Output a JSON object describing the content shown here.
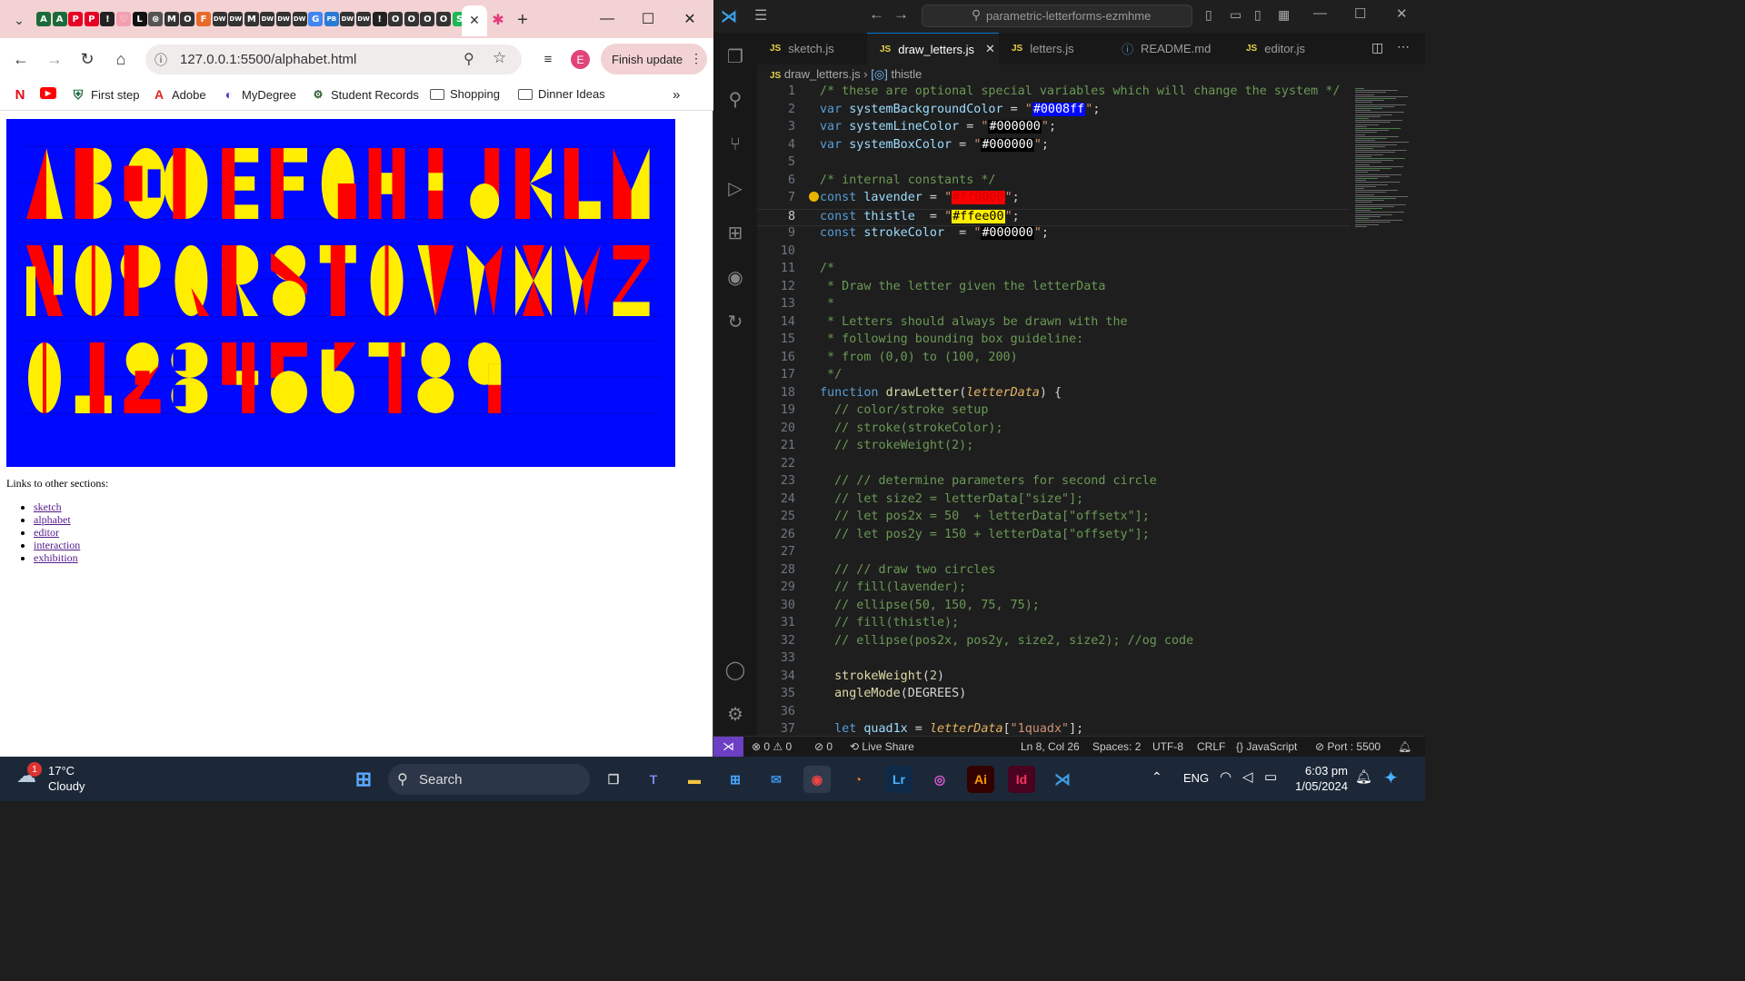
{
  "browser": {
    "favicons": [
      "A",
      "A",
      "P",
      "P",
      "!",
      "♡",
      "L",
      "⊛",
      "M",
      "O",
      "F",
      "DW",
      "DW",
      "M",
      "DW",
      "DW",
      "DW",
      "G",
      "PB",
      "DW",
      "DW",
      "!",
      "O",
      "O",
      "O",
      "O",
      "S"
    ],
    "url": "127.0.0.1:5500/alphabet.html",
    "profile_initial": "E",
    "finish_update_label": "Finish update",
    "bookmarks": [
      {
        "label": "",
        "icon": "N"
      },
      {
        "label": "",
        "icon": "▶"
      },
      {
        "label": "First step",
        "icon": "⛨"
      },
      {
        "label": "Adobe",
        "icon": "A"
      },
      {
        "label": "MyDegree",
        "icon": "◐"
      },
      {
        "label": "Student Records",
        "icon": "⚙"
      },
      {
        "label": "Shopping",
        "icon": "folder"
      },
      {
        "label": "Dinner Ideas",
        "icon": "folder"
      }
    ],
    "page": {
      "links_title": "Links to other sections:",
      "links": [
        "sketch",
        "alphabet",
        "editor",
        "interaction",
        "exhibition"
      ],
      "rows": [
        "ABCDEFGHIJKLM",
        "NOPQRSTUVWXYZ",
        "0123456789"
      ],
      "colors": {
        "background": "#0008ff",
        "primary": "#ff0000",
        "secondary": "#ffee00"
      }
    }
  },
  "vscode": {
    "search_text": "parametric-letterforms-ezmhme",
    "tabs": [
      {
        "label": "sketch.js",
        "active": false
      },
      {
        "label": "draw_letters.js",
        "active": true
      },
      {
        "label": "letters.js",
        "active": false
      },
      {
        "label": "README.md",
        "active": false
      },
      {
        "label": "editor.js",
        "active": false
      }
    ],
    "breadcrumb_file": "draw_letters.js",
    "breadcrumb_symbol": "thistle",
    "status": {
      "errors": "0",
      "warnings": "0",
      "ports": "0",
      "live_share": "Live Share",
      "position": "Ln 8, Col 26",
      "spaces": "Spaces: 2",
      "encoding": "UTF-8",
      "eol": "CRLF",
      "language": "JavaScript",
      "port": "Port : 5500"
    },
    "code_lines": [
      "/* these are optional special variables which will change the system */",
      "var systemBackgroundColor = \"#0008ff\";",
      "var systemLineColor = \"#000000\";",
      "var systemBoxColor = \"#000000\";",
      "",
      "/* internal constants */",
      "const lavender = \"#ff0000\";",
      "const thistle  = \"#ffee00\";",
      "const strokeColor  = \"#000000\";",
      "",
      "/*",
      " * Draw the letter given the letterData",
      " *",
      " * Letters should always be drawn with the",
      " * following bounding box guideline:",
      " * from (0,0) to (100, 200)",
      " */",
      "function drawLetter(letterData) {",
      "  // color/stroke setup",
      "  // stroke(strokeColor);",
      "  // strokeWeight(2);",
      "",
      "  // // determine parameters for second circle",
      "  // let size2 = letterData[\"size\"];",
      "  // let pos2x = 50  + letterData[\"offsetx\"];",
      "  // let pos2y = 150 + letterData[\"offsety\"];",
      "",
      "  // // draw two circles",
      "  // fill(lavender);",
      "  // ellipse(50, 150, 75, 75);",
      "  // fill(thistle);",
      "  // ellipse(pos2x, pos2y, size2, size2); //og code",
      "",
      "  strokeWeight(2)",
      "  angleMode(DEGREES)",
      "",
      "  let quad1x = letterData[\"1quadx\"];"
    ]
  },
  "taskbar": {
    "weather_temp": "17°C",
    "weather_desc": "Cloudy",
    "weather_badge": "1",
    "search_label": "Search",
    "lang": "ENG",
    "time": "6:03 pm",
    "date": "1/05/2024"
  }
}
